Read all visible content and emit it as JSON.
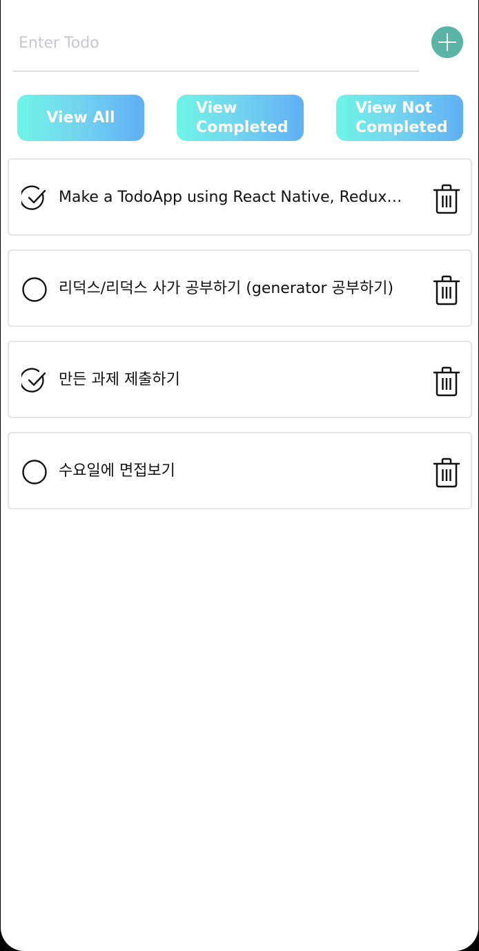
{
  "input": {
    "placeholder": "Enter Todo",
    "value": ""
  },
  "add_button": {
    "icon": "plus-icon",
    "color": "#5bb5a6"
  },
  "filters": {
    "all_label": "View All",
    "completed_line1": "View",
    "completed_line2": "Completed",
    "not_completed_line1": "View Not",
    "not_completed_line2": "Completed",
    "gradient_start": "#6ef5e6",
    "gradient_end": "#5fb0f5"
  },
  "todos": [
    {
      "text": "Make a TodoApp using React Native, Redux, Redux-Saga",
      "completed": true,
      "check_icon": "check-circle-icon",
      "delete_icon": "trash-icon"
    },
    {
      "text": "리덕스/리덕스 사가 공부하기 (generator 공부하기)",
      "completed": false,
      "check_icon": "empty-circle-icon",
      "delete_icon": "trash-icon"
    },
    {
      "text": "만든 과제 제출하기",
      "completed": true,
      "check_icon": "check-circle-icon",
      "delete_icon": "trash-icon"
    },
    {
      "text": "수요일에 면접보기",
      "completed": false,
      "check_icon": "empty-circle-icon",
      "delete_icon": "trash-icon"
    }
  ]
}
